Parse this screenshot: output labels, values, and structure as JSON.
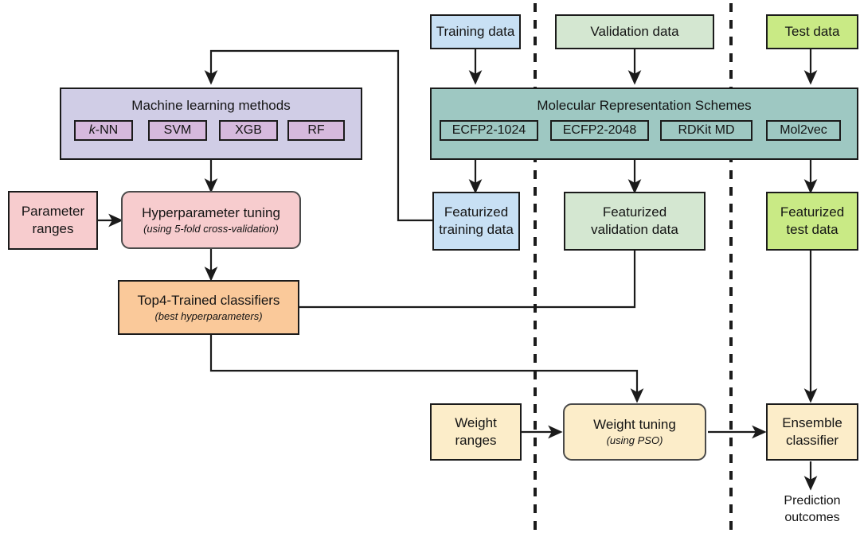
{
  "diagram": {
    "title_hidden": "Machine learning ensemble workflow",
    "colors": {
      "purple_group": "#d0cde6",
      "purple_chip": "#d6b9dd",
      "teal_group": "#9ec8c2",
      "teal_chip": "#9ec8c2",
      "blue": "#c8e0f4",
      "pale_green": "#d4e7d1",
      "yellow_green": "#c9ea85",
      "pink": "#f7ccce",
      "orange": "#fac99a",
      "cream": "#fcedc9",
      "stroke": "#1b1b1b",
      "stroke_soft": "#4a4a4a"
    },
    "ml_group": {
      "title": "Machine learning methods",
      "chips": [
        {
          "italic_prefix": "k",
          "rest": "-NN"
        },
        {
          "italic_prefix": "",
          "rest": "SVM"
        },
        {
          "italic_prefix": "",
          "rest": "XGB"
        },
        {
          "italic_prefix": "",
          "rest": "RF"
        }
      ]
    },
    "mrs_group": {
      "title": "Molecular Representation Schemes",
      "chips": [
        "ECFP2-1024",
        "ECFP2-2048",
        "RDKit MD",
        "Mol2vec"
      ]
    },
    "nodes": {
      "parameter_ranges": {
        "line1": "Parameter",
        "line2": "ranges"
      },
      "hyperparameter_tuning": {
        "line1": "Hyperparameter tuning",
        "sub": "(using 5-fold cross-validation)"
      },
      "top4_trained": {
        "line1": "Top4-Trained classifiers",
        "sub": "(best hyperparameters)"
      },
      "training_data": {
        "line1": "Training data"
      },
      "validation_data": {
        "line1": "Validation data"
      },
      "test_data": {
        "line1": "Test data"
      },
      "featurized_training": {
        "line1": "Featurized",
        "line2": "training data"
      },
      "featurized_validation": {
        "line1": "Featurized",
        "line2": "validation data"
      },
      "featurized_test": {
        "line1": "Featurized",
        "line2": "test data"
      },
      "weight_ranges": {
        "line1": "Weight",
        "line2": "ranges"
      },
      "weight_tuning": {
        "line1": "Weight tuning",
        "sub": "(using PSO)"
      },
      "ensemble_classifier": {
        "line1": "Ensemble",
        "line2": "classifier"
      },
      "prediction_outcomes": {
        "line1": "Prediction",
        "line2": "outcomes"
      }
    }
  }
}
